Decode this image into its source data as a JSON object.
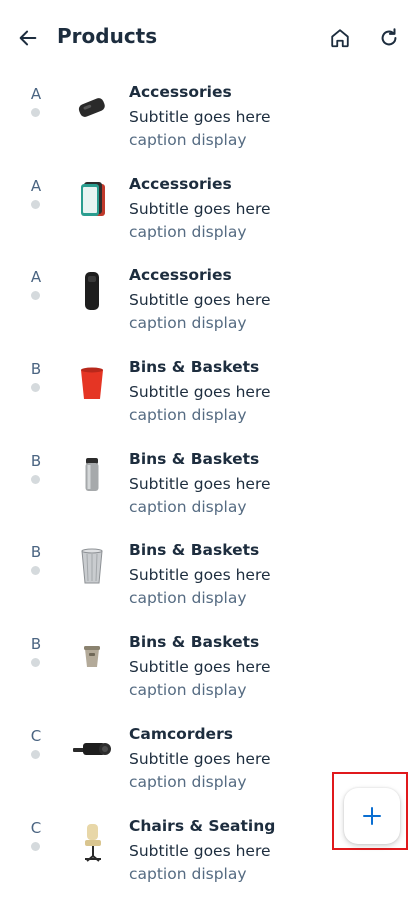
{
  "header": {
    "title": "Products",
    "icons": [
      "back-arrow-icon",
      "home-icon",
      "refresh-icon"
    ]
  },
  "products": [
    {
      "letter": "A",
      "title": "Accessories",
      "subtitle": "Subtitle goes here",
      "caption": "caption display",
      "image": "black-mouse"
    },
    {
      "letter": "A",
      "title": "Accessories",
      "subtitle": "Subtitle goes here",
      "caption": "caption display",
      "image": "phone-cases"
    },
    {
      "letter": "A",
      "title": "Accessories",
      "subtitle": "Subtitle goes here",
      "caption": "caption display",
      "image": "black-case"
    },
    {
      "letter": "B",
      "title": "Bins & Baskets",
      "subtitle": "Subtitle goes here",
      "caption": "caption display",
      "image": "red-bin"
    },
    {
      "letter": "B",
      "title": "Bins & Baskets",
      "subtitle": "Subtitle goes here",
      "caption": "caption display",
      "image": "steel-bin"
    },
    {
      "letter": "B",
      "title": "Bins & Baskets",
      "subtitle": "Subtitle goes here",
      "caption": "caption display",
      "image": "mesh-bin"
    },
    {
      "letter": "B",
      "title": "Bins & Baskets",
      "subtitle": "Subtitle goes here",
      "caption": "caption display",
      "image": "small-bin"
    },
    {
      "letter": "C",
      "title": "Camcorders",
      "subtitle": "Subtitle goes here",
      "caption": "caption display",
      "image": "camcorder"
    },
    {
      "letter": "C",
      "title": "Chairs & Seating",
      "subtitle": "Subtitle goes here",
      "caption": "caption display",
      "image": "office-chair"
    }
  ],
  "fab": {
    "label": "+",
    "icon": "plus-icon",
    "accent": "#0a6ed1"
  },
  "colors": {
    "text": "#1d2d3e",
    "secondary": "#556b82",
    "dot": "#d5dadd",
    "highlight": "#e0191c"
  }
}
